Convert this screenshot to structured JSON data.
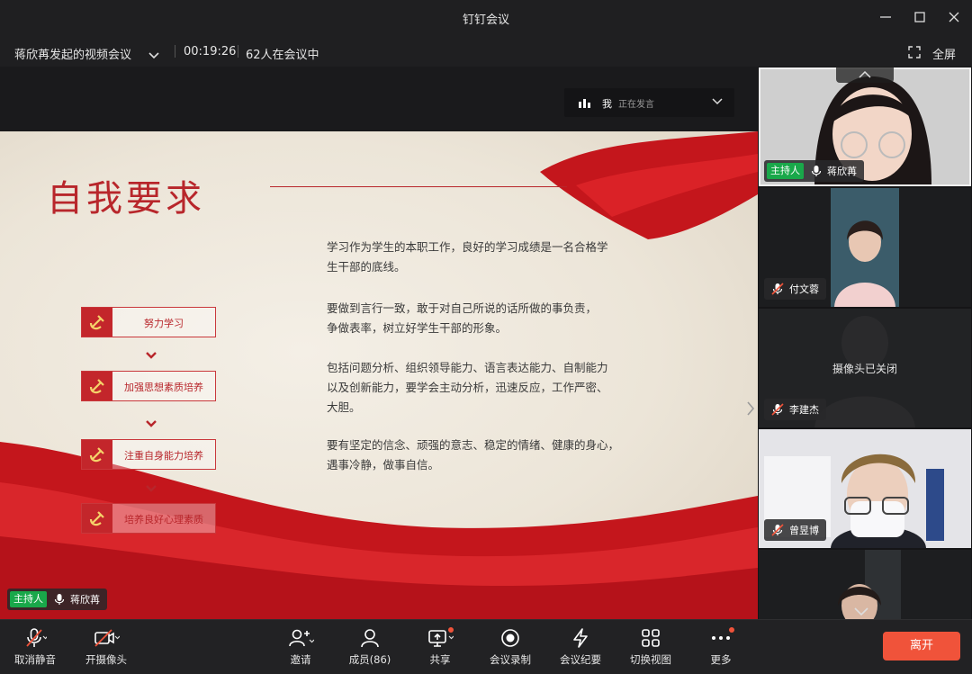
{
  "window": {
    "title": "钉钉会议"
  },
  "infobar": {
    "meeting_name": "蒋欣苒发起的视频会议",
    "duration": "00:19:26",
    "participants_in_meeting": "62人在会议中",
    "fullscreen_label": "全屏"
  },
  "slide": {
    "title": "自我要求",
    "steps": [
      {
        "label": "努力学习"
      },
      {
        "label": "加强思想素质培养"
      },
      {
        "label": "注重自身能力培养"
      },
      {
        "label": "培养良好心理素质"
      }
    ],
    "paragraphs": [
      {
        "line1": "学习作为学生的本职工作，良好的学习成绩是一名合格学",
        "line2": "生干部的底线。"
      },
      {
        "line1": "要做到言行一致，敢于对自己所说的话所做的事负责，",
        "line2": "争做表率，树立好学生干部的形象。"
      },
      {
        "line1": "包括问题分析、组织领导能力、语言表达能力、自制能力",
        "line2": "以及创新能力，要学会主动分析，迅速反应，工作严密、",
        "line3": "大胆。"
      },
      {
        "line1": "要有坚定的信念、顽强的意志、稳定的情绪、健康的身心，",
        "line2": "遇事冷静，做事自信。"
      }
    ]
  },
  "speaking_indicator": {
    "me_label": "我",
    "status": "正在发言"
  },
  "stage_nametag": {
    "host_badge": "主持人",
    "name": "蒋欣苒"
  },
  "participants": [
    {
      "name": "蒋欣苒",
      "host_badge": "主持人",
      "mic": "on"
    },
    {
      "name": "付文蓉",
      "mic": "muted"
    },
    {
      "name": "李建杰",
      "mic": "muted",
      "camera_status": "摄像头已关闭"
    },
    {
      "name": "曾昱博",
      "mic": "muted"
    },
    {
      "name": ""
    }
  ],
  "toolbar": {
    "unmute": "取消静音",
    "camera_on": "开摄像头",
    "invite": "邀请",
    "members": "成员(86)",
    "share": "共享",
    "record": "会议录制",
    "minutes": "会议纪要",
    "switch_view": "切换视图",
    "more": "更多",
    "leave": "离开"
  },
  "colors": {
    "accent_red": "#b8262b",
    "leave_button": "#f0533a",
    "host_badge": "#19a84a"
  }
}
